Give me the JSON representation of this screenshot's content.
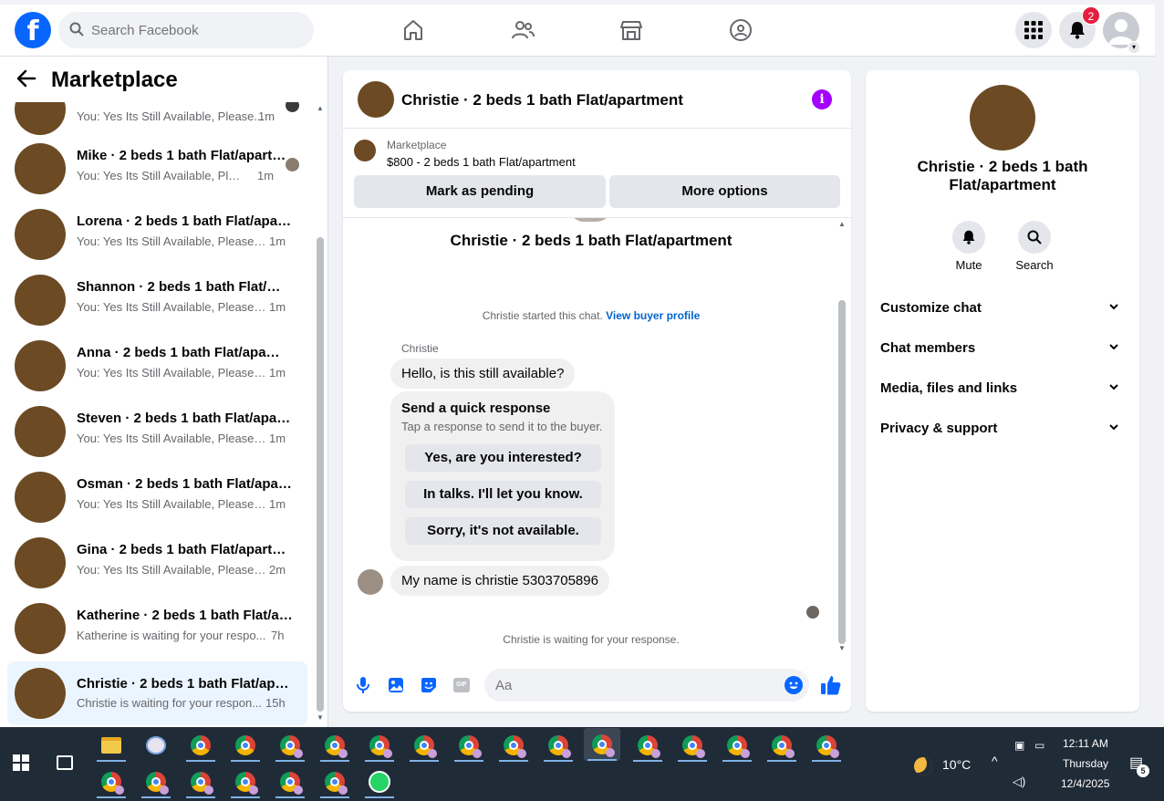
{
  "header": {
    "search_placeholder": "Search Facebook",
    "notification_count": "2"
  },
  "sidebar": {
    "title": "Marketplace",
    "conversations": [
      {
        "title": "",
        "preview": "You: Yes Its Still Available, Please...",
        "time": "1m"
      },
      {
        "title": "Mike · 2 beds 1 bath Flat/apartment",
        "preview": "You: Yes Its Still Available, Pleas...",
        "time": "1m"
      },
      {
        "title": "Lorena · 2 beds 1 bath Flat/apartment",
        "preview": "You: Yes Its Still Available, Please S...",
        "time": "1m"
      },
      {
        "title": "Shannon · 2 beds 1 bath Flat/apartment",
        "preview": "You: Yes Its Still Available, Please S...",
        "time": "1m"
      },
      {
        "title": "Anna · 2 beds 1 bath Flat/apartment",
        "preview": "You: Yes Its Still Available, Please S...",
        "time": "1m"
      },
      {
        "title": "Steven · 2 beds 1 bath Flat/apartment",
        "preview": "You: Yes Its Still Available, Please S...",
        "time": "1m"
      },
      {
        "title": "Osman · 2 beds 1 bath Flat/apartment",
        "preview": "You: Yes Its Still Available, Please S...",
        "time": "1m"
      },
      {
        "title": "Gina · 2 beds 1 bath Flat/apartment",
        "preview": "You: Yes Its Still Available, Please S...",
        "time": "2m"
      },
      {
        "title": "Katherine · 2 beds 1 bath Flat/apartment",
        "preview": "Katherine is waiting for your respo...",
        "time": "7h"
      },
      {
        "title": "Christie · 2 beds 1 bath Flat/apartment",
        "preview": "Christie is waiting for your respon...",
        "time": "15h"
      }
    ]
  },
  "chat": {
    "title": "Christie · 2 beds 1 bath Flat/apartment",
    "listing_label": "Marketplace",
    "listing_price": "$800 - 2 beds 1 bath Flat/apartment",
    "mark_pending": "Mark as pending",
    "more_options": "More options",
    "big_name": "Christie · 2 beds 1 bath Flat/apartment",
    "started_text": "Christie started this chat.",
    "buyer_profile_link": "View buyer profile",
    "sender_name": "Christie",
    "message_1": "Hello, is this still available?",
    "quick_title": "Send a quick response",
    "quick_subtitle": "Tap a response to send it to the buyer.",
    "quick_options": [
      "Yes, are you interested?",
      "In talks. I'll let you know.",
      "Sorry, it's not available."
    ],
    "message_2": "My name is christie 5303705896",
    "waiting_text": "Christie is waiting for your response.",
    "input_placeholder": "Aa"
  },
  "details": {
    "title": "Christie · 2 beds 1 bath Flat/apartment",
    "mute_label": "Mute",
    "search_label": "Search",
    "sections": [
      "Customize chat",
      "Chat members",
      "Media, files and links",
      "Privacy & support"
    ]
  },
  "taskbar": {
    "temperature": "10°C",
    "time": "12:11 AM",
    "day": "Thursday",
    "date": "12/4/2025",
    "notifications": "5"
  },
  "colors": {
    "brand": "#0866ff",
    "info": "#a200ff",
    "badge": "#e41e3f"
  }
}
